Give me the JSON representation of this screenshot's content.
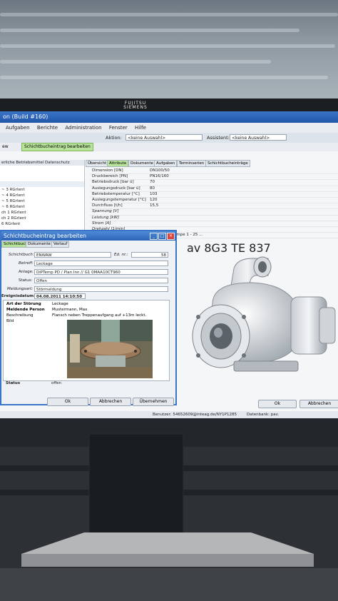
{
  "monitor": {
    "brand_line1": "FUJITSU",
    "brand_line2": "SIEMENS"
  },
  "app": {
    "title": "on (Build #160)",
    "menu": [
      "Aufgaben",
      "Berichte",
      "Administration",
      "Fenster",
      "Hilfe"
    ],
    "toolbar": {
      "aktion_label": "Aktion:",
      "aktion_value": "<keine Auswahl>",
      "assistent_label": "Assistent:",
      "assistent_value": "<keine Auswahl>"
    },
    "top_tabs": [
      "ew",
      "Schichtbucheintrag bearbeiten"
    ],
    "left_header": [
      "erliche Betriebsmittel",
      "Datenschutz"
    ],
    "left_items": [
      "~ 3 RGrIent",
      "~ 4 RGrIent",
      "~ 5 RGrIent",
      "~ 6 RGrIent",
      "ch 1 RGrIent",
      "ch 2 RGrIent",
      "6 RGrIent"
    ],
    "main_tabs": [
      "Übersicht",
      "Attribute",
      "Dokumente",
      "Aufgaben",
      "Terminserien",
      "Schichtbucheinträge"
    ],
    "attributes": [
      {
        "k": "Dimension [DN]",
        "v": "DN100/50"
      },
      {
        "k": "Druckbereich [PN]",
        "v": "PN16/160"
      },
      {
        "k": "Betriebsdruck [bar ü]",
        "v": "70"
      },
      {
        "k": "Auslegungsdruck [bar ü]",
        "v": "80"
      },
      {
        "k": "Betriebstemperatur [°C]",
        "v": "103"
      },
      {
        "k": "Auslegungstemperatur [°C]",
        "v": "120"
      },
      {
        "k": "Durchfluss [t/h]",
        "v": "15,5"
      },
      {
        "k": "Spannung [V]",
        "v": ""
      },
      {
        "k": "Leistung [kW]",
        "v": ""
      },
      {
        "k": "Strom [A]",
        "v": ""
      },
      {
        "k": "Drehzahl [1/min]",
        "v": ""
      },
      {
        "k": "Bauart",
        "v": "Zentrifugalpumpe 1 - 25 ..."
      }
    ],
    "attr_extra": "av 8G3 TE 837",
    "buttons_main": [
      "Ok",
      "Abbrechen"
    ],
    "status_left": "Benutzer: 54652609@inteag.de/NY1P1285",
    "status_right": "Datenbank: pav. dmo@mbrac01.avb.company"
  },
  "dialog": {
    "title": "Schichtbucheintrag bearbeiten",
    "tabs": [
      "Schichtbuch",
      "Dokumente",
      "Verlauf"
    ],
    "fields": {
      "schichtbuch_label": "Schichtbuch:",
      "schichtbuch_value": "ENWAW",
      "ed_label": "Ed. nr.:",
      "ed_value": "58",
      "betreff_label": "Betreff:",
      "betreff_value": "Leckage",
      "anlage_label": "Anlage:",
      "anlage_value": "DiPTemp PD / Plan Inn // G1 0MAA10CT960",
      "status_label": "Status:",
      "status_value": "Offen",
      "meldungsart_label": "Meldungsart:",
      "meldungsart_value": "Störmeldung",
      "ereignis_label": "Ereignisdatum:",
      "ereignis_value": "04.08.2011 14:10:50"
    },
    "grid": {
      "art_label": "Art der Störung",
      "art_value": "Leckage",
      "person_label": "Meldende Person",
      "person_value": "Mustermann, Max",
      "beschreibung_label": "Beschreibung",
      "beschreibung_value": "Flansch neben Treppenaufgang auf +13m leckt.",
      "bild_label": "Bild"
    },
    "status_row_label": "Status",
    "status_row_value": "offen",
    "buttons": [
      "Ok",
      "Abbrechen",
      "Übernehmen"
    ]
  }
}
